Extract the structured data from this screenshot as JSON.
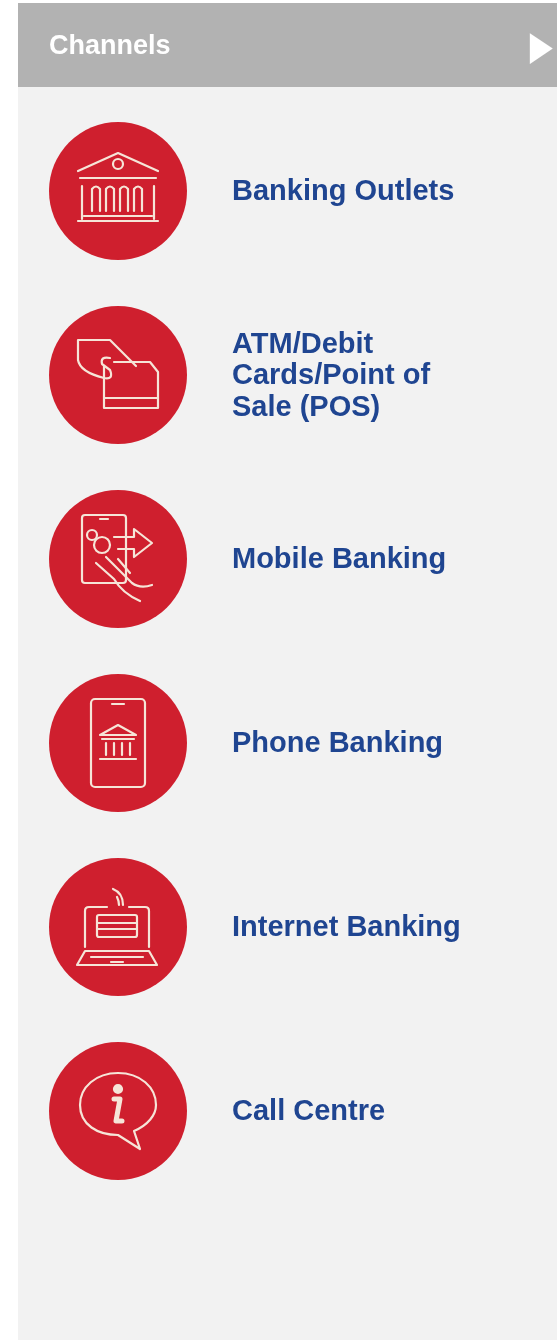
{
  "panel": {
    "title": "Channels",
    "expand_icon": "▶"
  },
  "channels": [
    {
      "label": "Banking Outlets",
      "kind": "bank"
    },
    {
      "label": "ATM/Debit Cards/Point of Sale (POS)",
      "kind": "card"
    },
    {
      "label": "Mobile Banking",
      "kind": "mobile"
    },
    {
      "label": "Phone Banking",
      "kind": "phone"
    },
    {
      "label": "Internet Banking",
      "kind": "laptop"
    },
    {
      "label": "Call Centre",
      "kind": "info"
    }
  ]
}
